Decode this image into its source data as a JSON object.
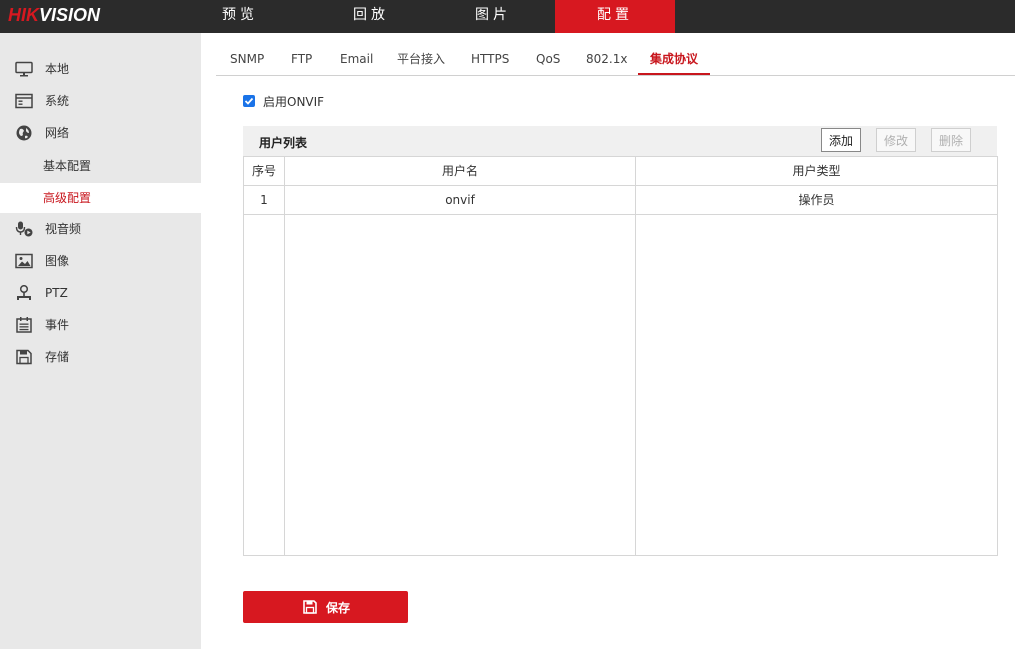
{
  "brand": {
    "logo_hik": "HIK",
    "logo_vision": "VISION",
    "accent": "#d71820"
  },
  "topnav": {
    "items": [
      {
        "label": "预览"
      },
      {
        "label": "回放"
      },
      {
        "label": "图片"
      },
      {
        "label": "配置"
      }
    ],
    "active": "配置"
  },
  "sidebar": {
    "items": [
      {
        "label": "本地",
        "icon": "monitor-icon"
      },
      {
        "label": "系统",
        "icon": "system-icon"
      },
      {
        "label": "网络",
        "icon": "globe-icon"
      },
      {
        "label": "基本配置",
        "sub": true
      },
      {
        "label": "高级配置",
        "sub": true,
        "selected": true
      },
      {
        "label": "视音频",
        "icon": "mic-video-icon"
      },
      {
        "label": "图像",
        "icon": "image-icon"
      },
      {
        "label": "PTZ",
        "icon": "ptz-icon"
      },
      {
        "label": "事件",
        "icon": "calendar-icon"
      },
      {
        "label": "存储",
        "icon": "storage-icon"
      }
    ]
  },
  "tabs": {
    "items": [
      {
        "label": "SNMP"
      },
      {
        "label": "FTP"
      },
      {
        "label": "Email"
      },
      {
        "label": "平台接入"
      },
      {
        "label": "HTTPS"
      },
      {
        "label": "QoS"
      },
      {
        "label": "802.1x"
      },
      {
        "label": "集成协议"
      }
    ],
    "active": "集成协议"
  },
  "onvif": {
    "label": "启用ONVIF",
    "checked": true
  },
  "user_list": {
    "title": "用户列表",
    "buttons": {
      "add": "添加",
      "modify": "修改",
      "delete": "删除"
    },
    "columns": [
      "序号",
      "用户名",
      "用户类型"
    ],
    "rows": [
      {
        "index": "1",
        "username": "onvif",
        "type": "操作员"
      }
    ]
  },
  "save": {
    "label": "保存"
  }
}
